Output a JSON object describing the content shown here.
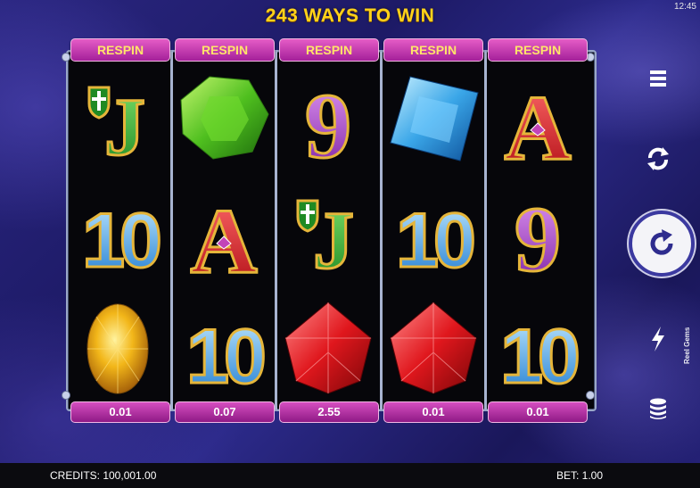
{
  "status_bar": {
    "time": "12:45"
  },
  "title": "243 WAYS TO WIN",
  "reels": [
    {
      "respin_label": "RESPIN",
      "win": "0.01",
      "symbols": [
        "J",
        "10",
        "yellow-gem"
      ]
    },
    {
      "respin_label": "RESPIN",
      "win": "0.07",
      "symbols": [
        "green-gem",
        "A",
        "10"
      ]
    },
    {
      "respin_label": "RESPIN",
      "win": "2.55",
      "symbols": [
        "9",
        "J",
        "red-gem"
      ]
    },
    {
      "respin_label": "RESPIN",
      "win": "0.01",
      "symbols": [
        "blue-gem",
        "10",
        "red-gem"
      ]
    },
    {
      "respin_label": "RESPIN",
      "win": "0.01",
      "symbols": [
        "A",
        "9",
        "10"
      ]
    }
  ],
  "side_menu": {
    "icons": [
      "menu-icon",
      "autoplay-icon",
      "spin-icon",
      "turbo-icon",
      "coins-icon"
    ]
  },
  "game_name": "Reel Gems",
  "footer": {
    "credits": "CREDITS: 100,001.00",
    "bet": "BET: 1.00"
  },
  "colors": {
    "title": "#ffd21a",
    "respin_bg": "#c83cb4",
    "respin_text": "#ffe46a",
    "background": "#1c1a5c"
  }
}
